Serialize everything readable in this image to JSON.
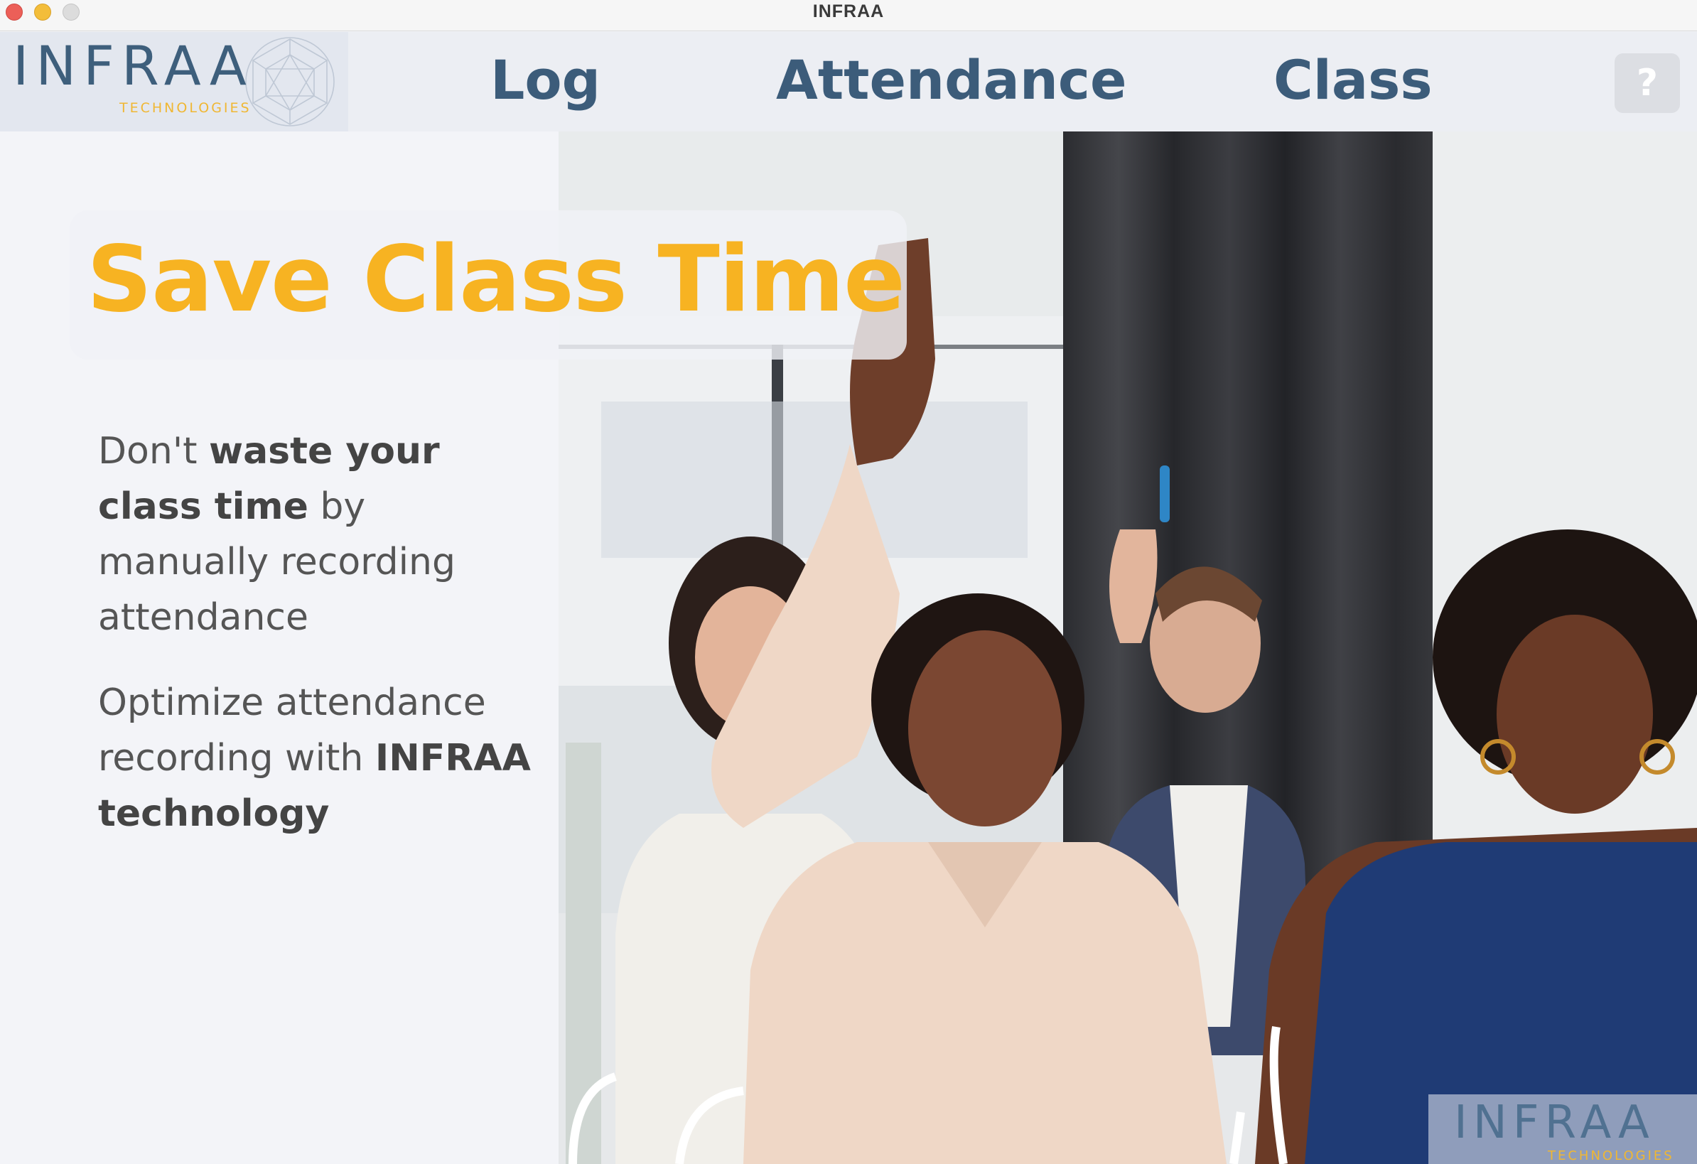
{
  "window": {
    "title": "INFRAA"
  },
  "logo": {
    "text": "INFRAA",
    "subtext": "TECHNOLOGIES",
    "icon": "geodesic-globe-icon"
  },
  "nav": {
    "items": [
      {
        "label": "Log"
      },
      {
        "label": "Attendance"
      },
      {
        "label": "Class"
      }
    ],
    "help_label": "?"
  },
  "hero": {
    "headline": "Save Class Time",
    "para1": {
      "t1": "Don't ",
      "b1": "waste your class time",
      "t2": " by manually recording attendance"
    },
    "para2": {
      "t1": "Optimize attendance recording with ",
      "b1": "INFRAA technology"
    }
  },
  "watermark": {
    "text": "INFRAA",
    "subtext": "TECHNOLOGIES"
  },
  "colors": {
    "accent": "#f7b322",
    "brand": "#3c5c7a"
  }
}
